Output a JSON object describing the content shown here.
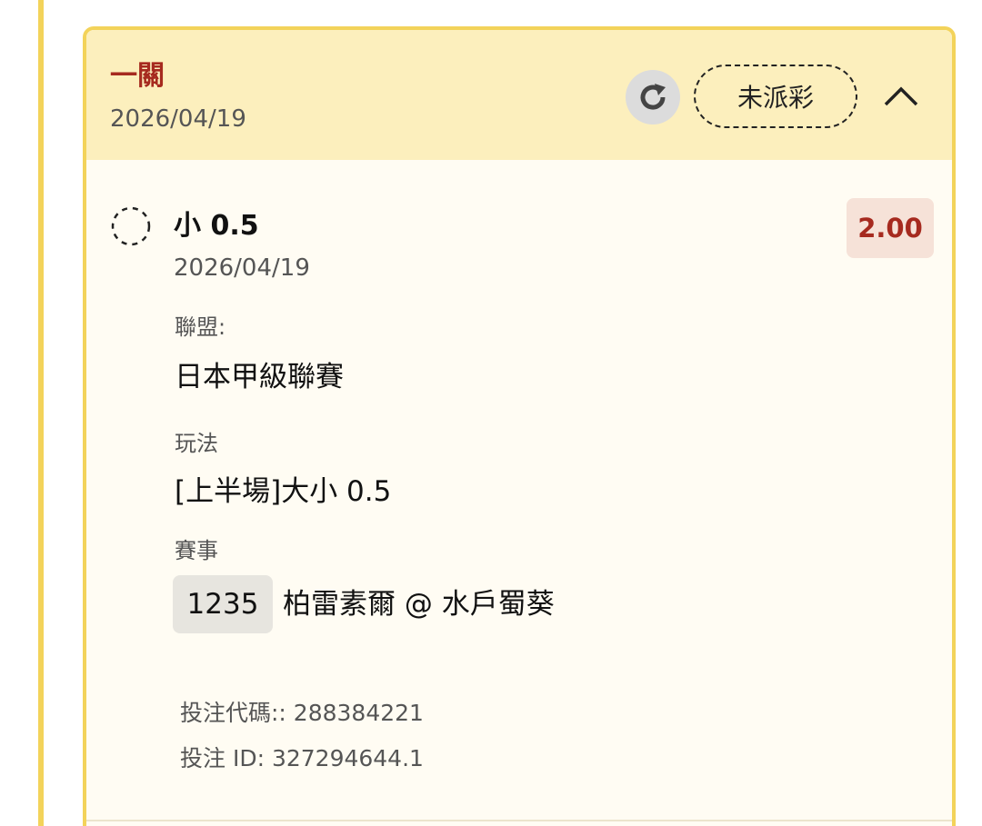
{
  "bet": {
    "type_label": "一關",
    "date": "2026/04/19",
    "status_label": "未派彩"
  },
  "selection": {
    "title": "小 0.5",
    "date": "2026/04/19",
    "odds": "2.00",
    "league_label": "聯盟:",
    "league_value": "日本甲級聯賽",
    "market_label": "玩法",
    "market_value": "[上半場]大小 0.5",
    "event_label": "賽事",
    "event_id": "1235",
    "event_name": "柏雷素爾 @ 水戶蜀葵"
  },
  "meta": {
    "bet_code": "投注代碼:: 288384221",
    "bet_id": "投注 ID: 327294644.1"
  },
  "icons": {
    "refresh": "refresh-icon",
    "collapse": "chevron-up-icon",
    "pending": "pending-circle-icon"
  },
  "colors": {
    "accent_border": "#f3d35a",
    "header_bg": "#fcefbd",
    "brand_red": "#a62a1f",
    "odds_bg": "#f6e2d8"
  }
}
